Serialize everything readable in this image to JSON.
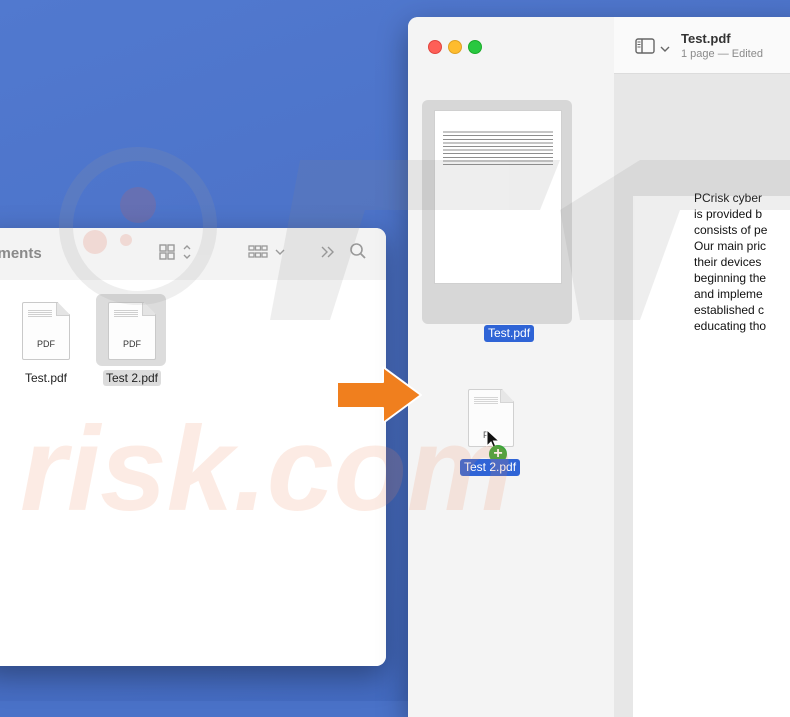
{
  "finder": {
    "title": "cuments",
    "files": [
      {
        "name": "Test.pdf",
        "type_label": "PDF",
        "selected": false
      },
      {
        "name": "Test 2.pdf",
        "type_label": "PDF",
        "selected": true
      }
    ]
  },
  "preview": {
    "title": "Test.pdf",
    "subtitle": "1 page — Edited",
    "thumbnail_label": "Test.pdf",
    "dragged_label": "Test 2.pdf",
    "dragged_type_label": "P",
    "add_symbol": "+",
    "page_lines": [
      "PCrisk cyber",
      "is provided b",
      "consists of pe",
      "Our main pric",
      "their devices",
      "beginning the",
      "and impleme",
      "established c",
      "educating tho"
    ]
  },
  "watermark": {
    "text": "risk.com"
  },
  "colors": {
    "accent": "#2f64d6",
    "arrow": "#f07f1e",
    "desktop": "#4a72c8",
    "close": "#fe5f57",
    "minimize": "#febc2e",
    "zoom": "#28c840",
    "add": "#3aa53a"
  }
}
